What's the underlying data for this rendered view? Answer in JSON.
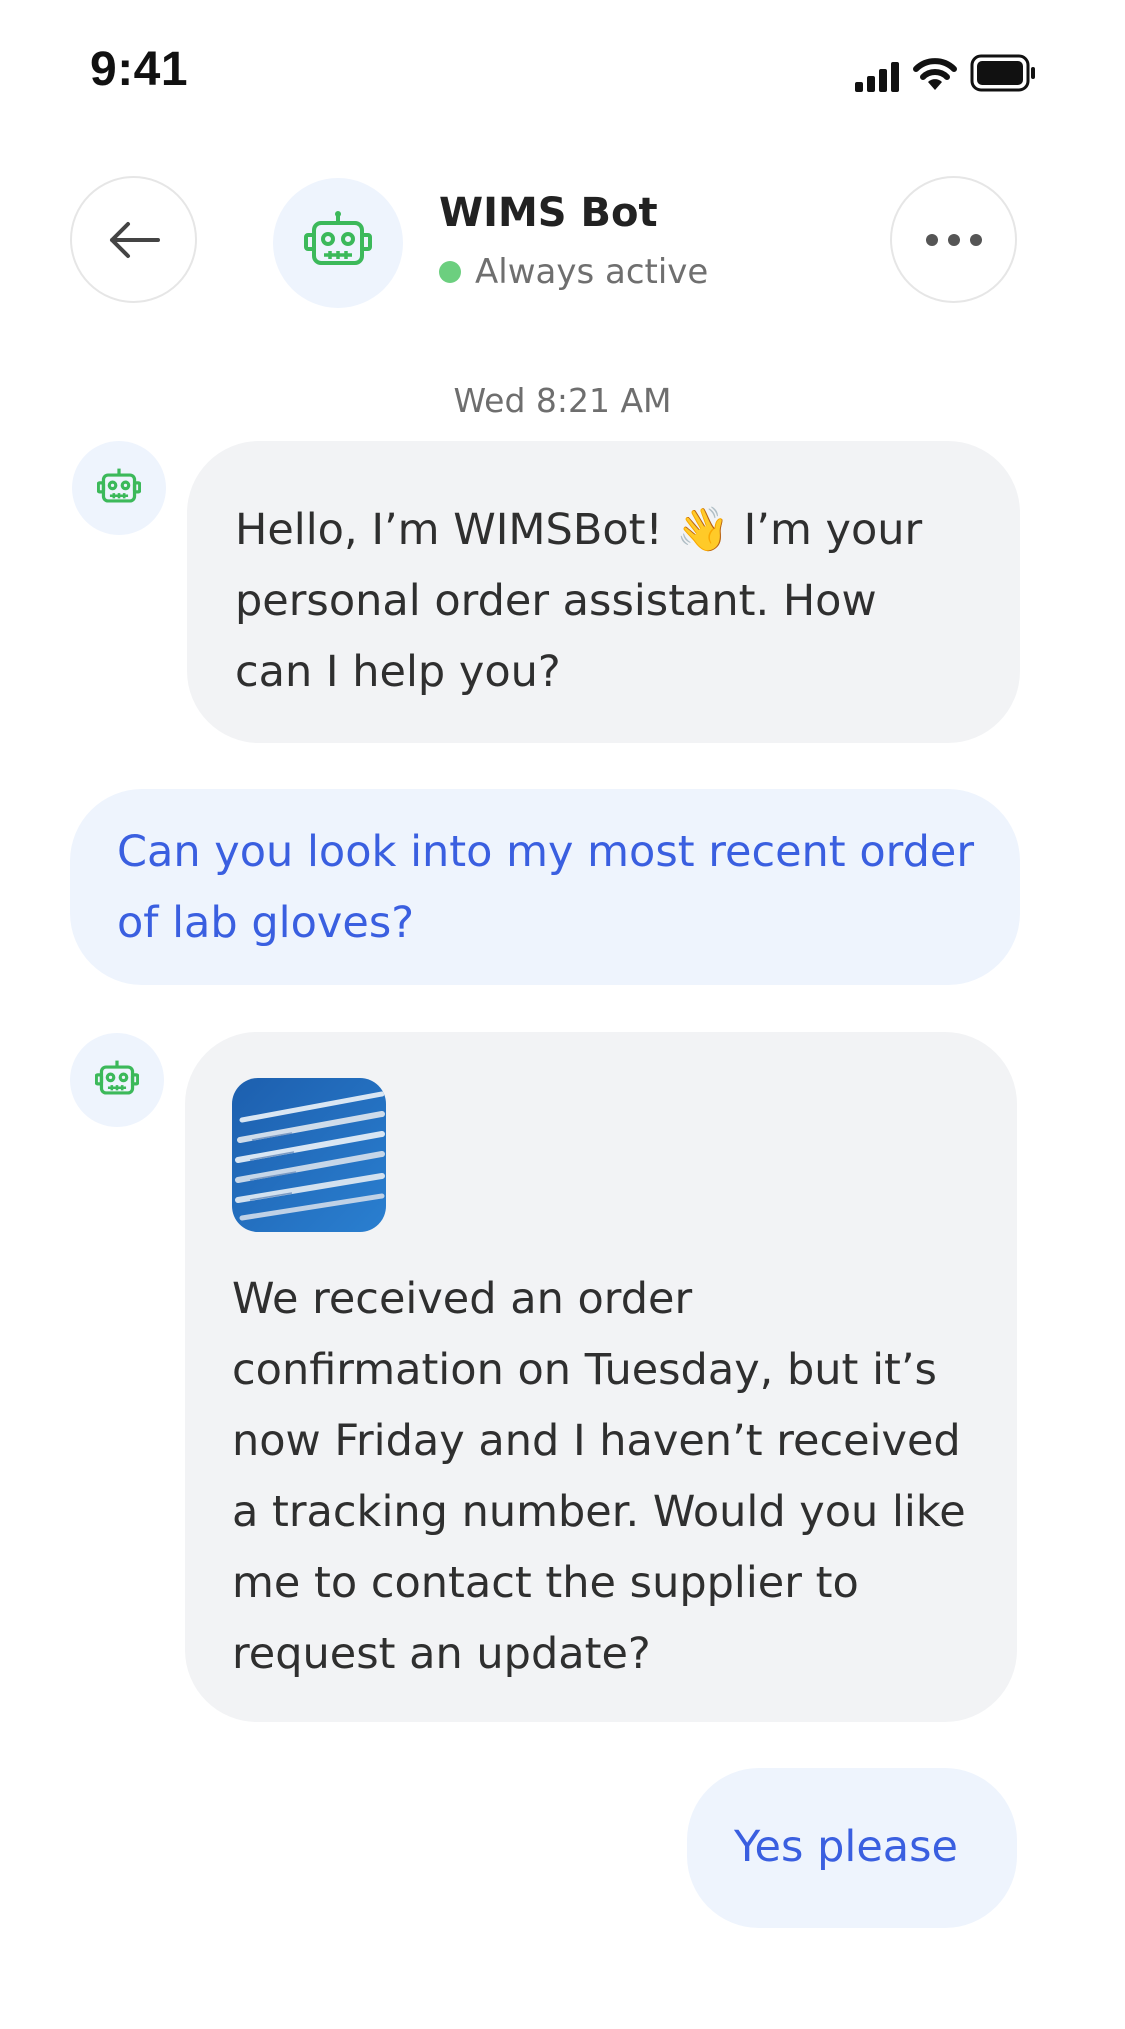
{
  "status_bar": {
    "time": "9:41",
    "icons": [
      "cellular-signal-icon",
      "wifi-icon",
      "battery-icon"
    ]
  },
  "header": {
    "back_icon": "arrow-left-icon",
    "bot_name": "WIMS Bot",
    "status_text": "Always active",
    "status_color": "#6ccf7f",
    "more_icon": "ellipsis-icon",
    "avatar_icon": "robot-icon"
  },
  "conversation": {
    "timestamp": "Wed 8:21 AM",
    "messages": [
      {
        "sender": "bot",
        "text": "Hello, I’m WIMSBot! 👋 I’m your personal order assistant. How can I help you?"
      },
      {
        "sender": "user",
        "text": "Can you look into my most recent order of lab gloves?"
      },
      {
        "sender": "bot",
        "image_icon": "lab-pipettes-image",
        "text": "We received an order confirmation on Tuesday, but it’s now Friday and I haven’t received a tracking number. Would you like me to contact the supplier to request an update?"
      },
      {
        "sender": "user",
        "text": "Yes please"
      }
    ]
  },
  "colors": {
    "accent_text": "#3a5fe0",
    "user_bubble": "#eef4fd",
    "bot_bubble": "#f2f3f5",
    "robot_icon": "#3cb95a"
  }
}
